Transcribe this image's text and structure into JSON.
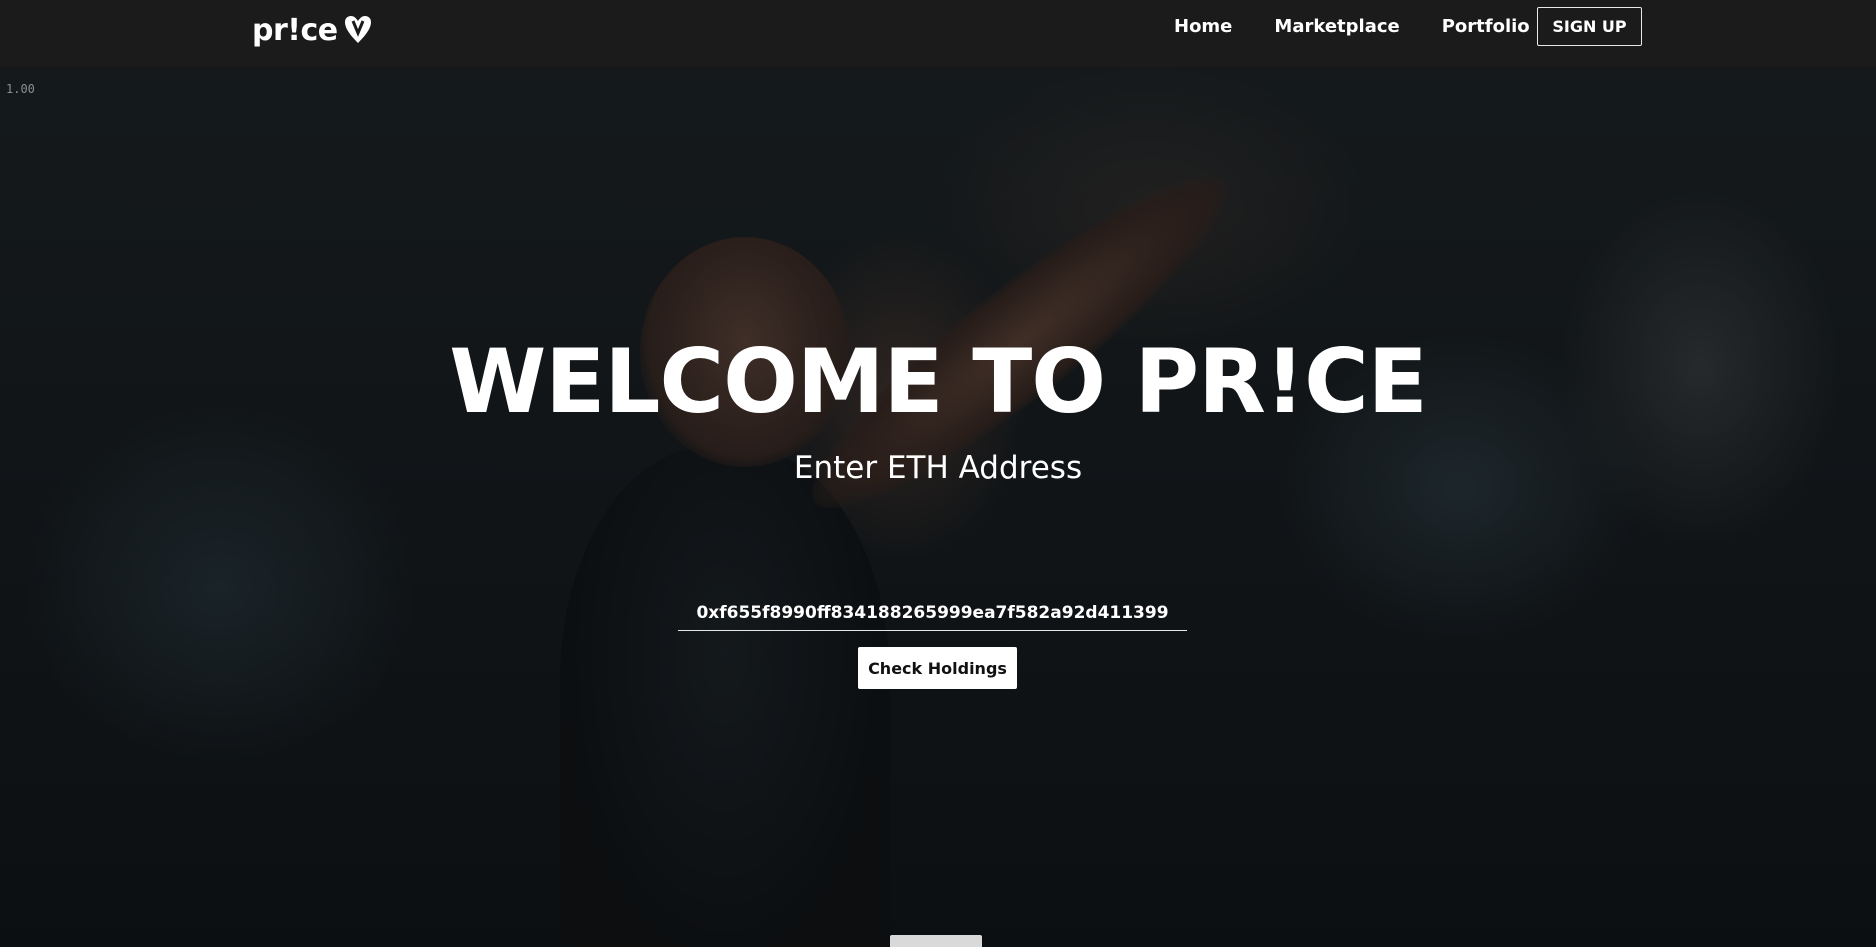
{
  "nav": {
    "logo_text": "pr!ce",
    "links": [
      "Home",
      "Marketplace",
      "Portfolio"
    ],
    "signup_label": "SIGN UP"
  },
  "badge": {
    "zoom": "1.00"
  },
  "hero": {
    "title": "WELCOME TO PR!CE",
    "subtitle": "Enter ETH Address",
    "address_value": "0xf655f8990ff834188265999ea7f582a92d411399",
    "check_label": "Check Holdings"
  },
  "colors": {
    "navbar": "#1c1b1b",
    "button_bg": "#ffffff",
    "text": "#ffffff"
  }
}
